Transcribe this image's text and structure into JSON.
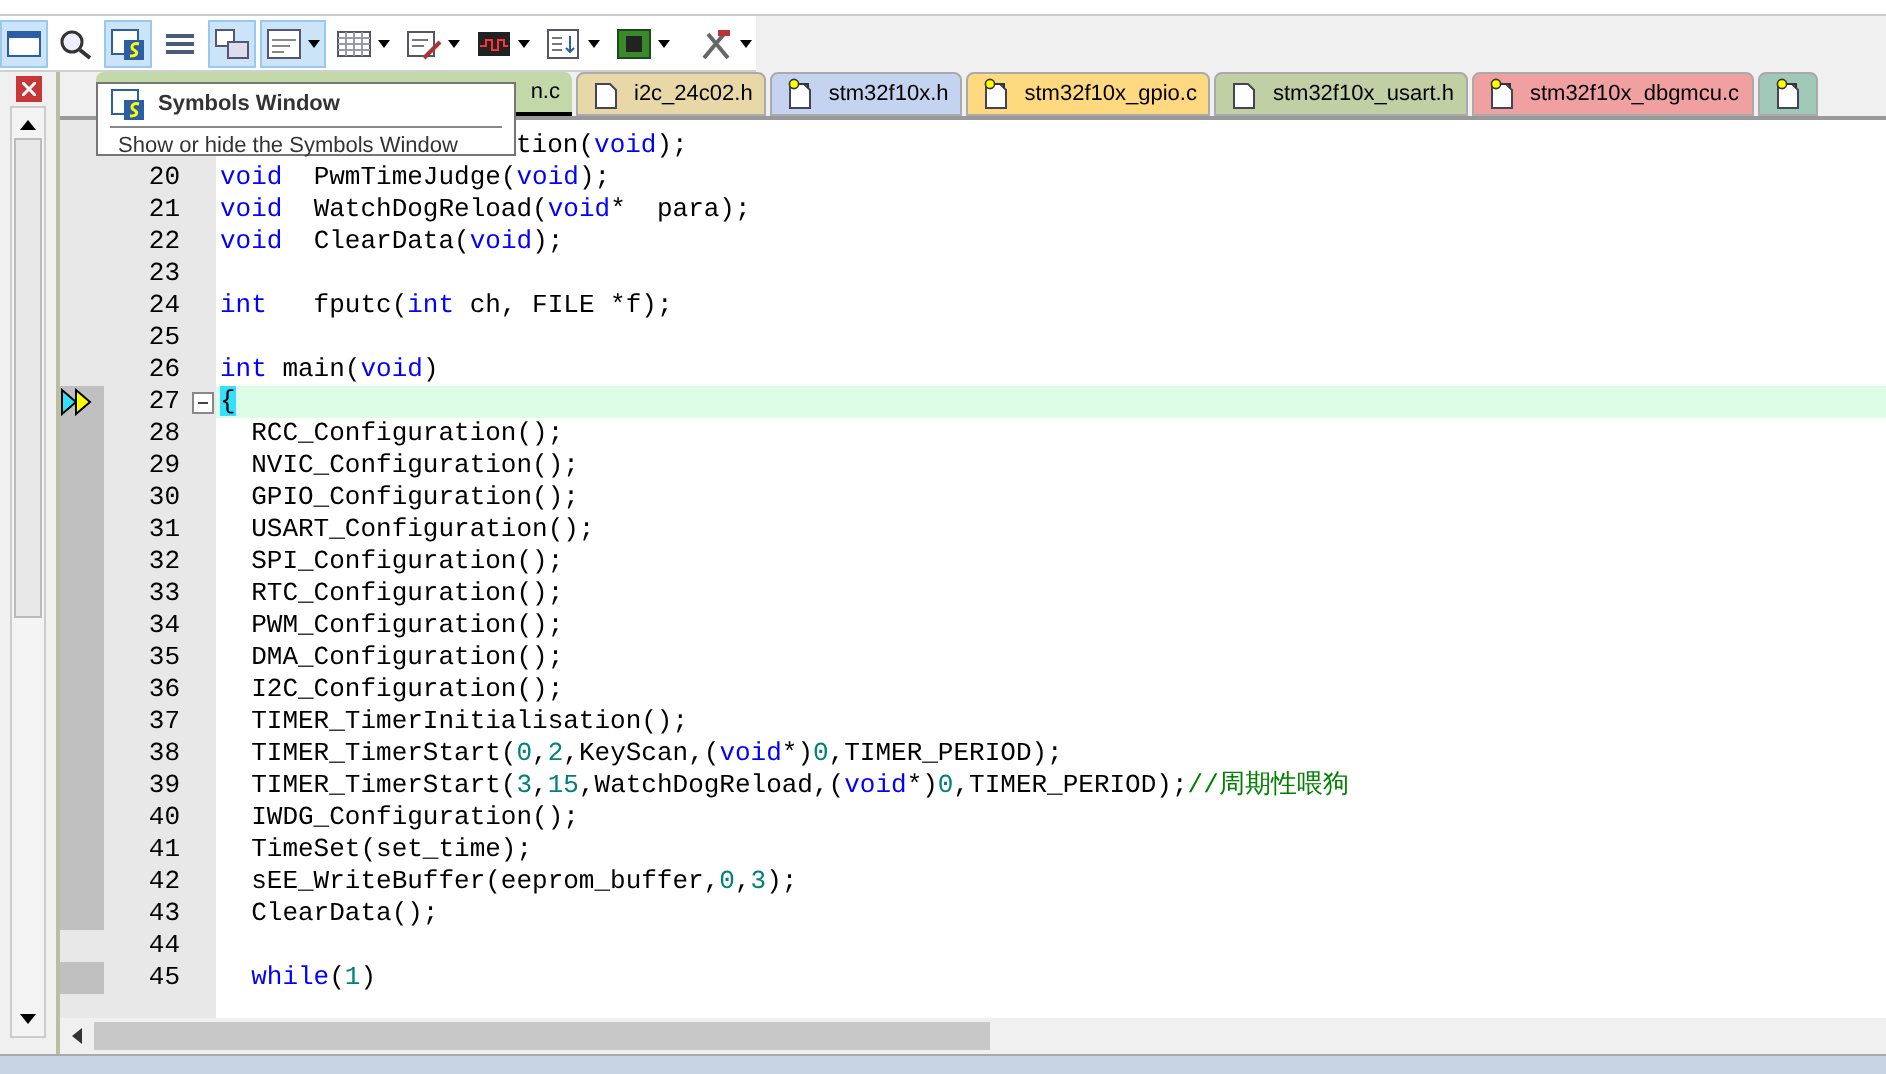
{
  "toolbar": [
    {
      "kind": "window",
      "pressed": true,
      "dropdown": false
    },
    {
      "kind": "find",
      "pressed": false,
      "dropdown": false
    },
    {
      "kind": "symbols",
      "pressed": true,
      "dropdown": false
    },
    {
      "kind": "lines",
      "pressed": false,
      "dropdown": false
    },
    {
      "kind": "windows",
      "pressed": true,
      "dropdown": false
    },
    {
      "kind": "dialog",
      "pressed": true,
      "dropdown": true
    },
    {
      "kind": "grid",
      "pressed": false,
      "dropdown": true
    },
    {
      "kind": "edit",
      "pressed": false,
      "dropdown": true
    },
    {
      "kind": "wave",
      "pressed": false,
      "dropdown": true
    },
    {
      "kind": "list",
      "pressed": false,
      "dropdown": true
    },
    {
      "kind": "chip",
      "pressed": false,
      "dropdown": true
    },
    {
      "kind": "tools",
      "pressed": false,
      "dropdown": true
    }
  ],
  "tabs": [
    {
      "label": "n.c",
      "selected": true,
      "color": "#c2d8a8",
      "covered": true
    },
    {
      "label": "i2c_24c02.h",
      "selected": false,
      "color": "#e8d8a8",
      "kind": "plain"
    },
    {
      "label": "stm32f10x.h",
      "selected": false,
      "color": "#c4d4f0",
      "kind": "key"
    },
    {
      "label": "stm32f10x_gpio.c",
      "selected": false,
      "color": "#ffd980",
      "kind": "key"
    },
    {
      "label": "stm32f10x_usart.h",
      "selected": false,
      "color": "#c0d0a4",
      "kind": "plain"
    },
    {
      "label": "stm32f10x_dbgmcu.c",
      "selected": false,
      "color": "#f0a0a0",
      "kind": "key"
    },
    {
      "selected": false,
      "color": "#a0c8b8",
      "kind": "key"
    }
  ],
  "tooltip": {
    "title": "Symbols Window",
    "description": "Show or hide the Symbols Window"
  },
  "lines": [
    {
      "covered": true,
      "mark": false,
      "current": false,
      "fold": false,
      "tokens": [
        {
          "kind": "plain",
          "text": "tion("
        },
        {
          "kind": "kw",
          "text": "void"
        },
        {
          "kind": "plain",
          "text": ");"
        }
      ]
    },
    {
      "number": "20",
      "mark": false,
      "current": false,
      "fold": false,
      "tokens": [
        {
          "kind": "kw",
          "text": "void"
        },
        {
          "kind": "plain",
          "text": "  PwmTimeJudge("
        },
        {
          "kind": "kw",
          "text": "void"
        },
        {
          "kind": "plain",
          "text": ");"
        }
      ]
    },
    {
      "number": "21",
      "mark": false,
      "current": false,
      "fold": false,
      "tokens": [
        {
          "kind": "kw",
          "text": "void"
        },
        {
          "kind": "plain",
          "text": "  WatchDogReload("
        },
        {
          "kind": "kw",
          "text": "void"
        },
        {
          "kind": "plain",
          "text": "*  para);"
        }
      ]
    },
    {
      "number": "22",
      "mark": false,
      "current": false,
      "fold": false,
      "tokens": [
        {
          "kind": "kw",
          "text": "void"
        },
        {
          "kind": "plain",
          "text": "  ClearData("
        },
        {
          "kind": "kw",
          "text": "void"
        },
        {
          "kind": "plain",
          "text": ");"
        }
      ]
    },
    {
      "number": "23",
      "mark": false,
      "current": false,
      "fold": false
    },
    {
      "number": "24",
      "mark": false,
      "current": false,
      "fold": false,
      "tokens": [
        {
          "kind": "kw",
          "text": "int"
        },
        {
          "kind": "plain",
          "text": "   fputc("
        },
        {
          "kind": "kw",
          "text": "int"
        },
        {
          "kind": "plain",
          "text": " ch, FILE *f);"
        }
      ]
    },
    {
      "number": "25",
      "mark": false,
      "current": false,
      "fold": false
    },
    {
      "number": "26",
      "mark": false,
      "current": false,
      "fold": false,
      "tokens": [
        {
          "kind": "kw",
          "text": "int"
        },
        {
          "kind": "plain",
          "text": " main("
        },
        {
          "kind": "kw",
          "text": "void"
        },
        {
          "kind": "plain",
          "text": ")"
        }
      ]
    },
    {
      "number": "27",
      "mark": true,
      "current": true,
      "fold": true,
      "tokens": [
        {
          "kind": "brace",
          "text": "{"
        }
      ]
    },
    {
      "number": "28",
      "mark": true,
      "current": false,
      "fold": false,
      "tokens": [
        {
          "kind": "plain",
          "text": "  RCC_Configuration();"
        }
      ]
    },
    {
      "number": "29",
      "mark": true,
      "current": false,
      "fold": false,
      "tokens": [
        {
          "kind": "plain",
          "text": "  NVIC_Configuration();"
        }
      ]
    },
    {
      "number": "30",
      "mark": true,
      "current": false,
      "fold": false,
      "tokens": [
        {
          "kind": "plain",
          "text": "  GPIO_Configuration();"
        }
      ]
    },
    {
      "number": "31",
      "mark": true,
      "current": false,
      "fold": false,
      "tokens": [
        {
          "kind": "plain",
          "text": "  USART_Configuration();"
        }
      ]
    },
    {
      "number": "32",
      "mark": true,
      "current": false,
      "fold": false,
      "tokens": [
        {
          "kind": "plain",
          "text": "  SPI_Configuration();"
        }
      ]
    },
    {
      "number": "33",
      "mark": true,
      "current": false,
      "fold": false,
      "tokens": [
        {
          "kind": "plain",
          "text": "  RTC_Configuration();"
        }
      ]
    },
    {
      "number": "34",
      "mark": true,
      "current": false,
      "fold": false,
      "tokens": [
        {
          "kind": "plain",
          "text": "  PWM_Configuration();"
        }
      ]
    },
    {
      "number": "35",
      "mark": true,
      "current": false,
      "fold": false,
      "tokens": [
        {
          "kind": "plain",
          "text": "  DMA_Configuration();"
        }
      ]
    },
    {
      "number": "36",
      "mark": true,
      "current": false,
      "fold": false,
      "tokens": [
        {
          "kind": "plain",
          "text": "  I2C_Configuration();"
        }
      ]
    },
    {
      "number": "37",
      "mark": true,
      "current": false,
      "fold": false,
      "tokens": [
        {
          "kind": "plain",
          "text": "  TIMER_TimerInitialisation();"
        }
      ]
    },
    {
      "number": "38",
      "mark": true,
      "current": false,
      "fold": false,
      "tokens": [
        {
          "kind": "plain",
          "text": "  TIMER_TimerStart("
        },
        {
          "kind": "num",
          "text": "0"
        },
        {
          "kind": "plain",
          "text": ","
        },
        {
          "kind": "num",
          "text": "2"
        },
        {
          "kind": "plain",
          "text": ",KeyScan,("
        },
        {
          "kind": "kw",
          "text": "void"
        },
        {
          "kind": "plain",
          "text": "*)"
        },
        {
          "kind": "num",
          "text": "0"
        },
        {
          "kind": "plain",
          "text": ",TIMER_PERIOD);"
        }
      ]
    },
    {
      "number": "39",
      "mark": true,
      "current": false,
      "fold": false,
      "tokens": [
        {
          "kind": "plain",
          "text": "  TIMER_TimerStart("
        },
        {
          "kind": "num",
          "text": "3"
        },
        {
          "kind": "plain",
          "text": ","
        },
        {
          "kind": "num",
          "text": "15"
        },
        {
          "kind": "plain",
          "text": ",WatchDogReload,("
        },
        {
          "kind": "kw",
          "text": "void"
        },
        {
          "kind": "plain",
          "text": "*)"
        },
        {
          "kind": "num",
          "text": "0"
        },
        {
          "kind": "plain",
          "text": ",TIMER_PERIOD);"
        },
        {
          "kind": "comment",
          "text": "//周期性喂狗"
        }
      ]
    },
    {
      "number": "40",
      "mark": true,
      "current": false,
      "fold": false,
      "tokens": [
        {
          "kind": "plain",
          "text": "  IWDG_Configuration();"
        }
      ]
    },
    {
      "number": "41",
      "mark": true,
      "current": false,
      "fold": false,
      "tokens": [
        {
          "kind": "plain",
          "text": "  TimeSet(set_time);"
        }
      ]
    },
    {
      "number": "42",
      "mark": true,
      "current": false,
      "fold": false,
      "tokens": [
        {
          "kind": "plain",
          "text": "  sEE_WriteBuffer(eeprom_buffer,"
        },
        {
          "kind": "num",
          "text": "0"
        },
        {
          "kind": "plain",
          "text": ","
        },
        {
          "kind": "num",
          "text": "3"
        },
        {
          "kind": "plain",
          "text": ");"
        }
      ]
    },
    {
      "number": "43",
      "mark": true,
      "current": false,
      "fold": false,
      "tokens": [
        {
          "kind": "plain",
          "text": "  ClearData();"
        }
      ]
    },
    {
      "number": "44",
      "mark": false,
      "current": false,
      "fold": false
    },
    {
      "number": "45",
      "mark": true,
      "current": false,
      "fold": false,
      "tokens": [
        {
          "kind": "kw",
          "text": "  while"
        },
        {
          "kind": "plain",
          "text": "("
        },
        {
          "kind": "num",
          "text": "1"
        },
        {
          "kind": "plain",
          "text": ")"
        }
      ]
    }
  ]
}
